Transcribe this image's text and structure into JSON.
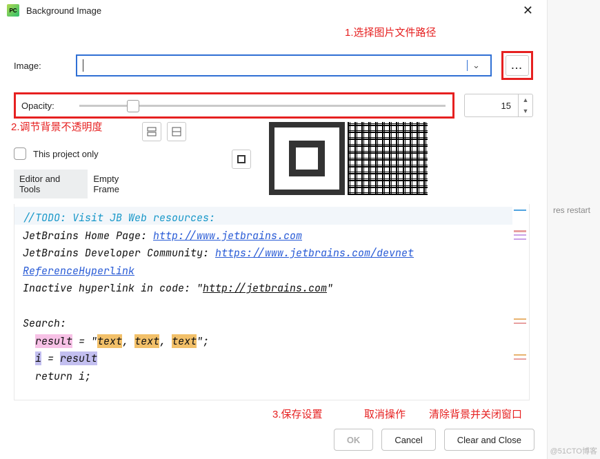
{
  "window": {
    "title": "Background Image",
    "close_glyph": "✕"
  },
  "annotations": {
    "a1": "1.选择图片文件路径",
    "a2": "2.调节背景不透明度",
    "a3": "3.保存设置",
    "a4": "取消操作",
    "a5": "清除背景并关闭窗口"
  },
  "image_row": {
    "label": "Image:",
    "value": "",
    "browse": "..."
  },
  "opacity_row": {
    "label": "Opacity:",
    "value": "15"
  },
  "project_only": {
    "label": "This project only",
    "checked": false
  },
  "tabs": {
    "editorTools": "Editor and Tools",
    "emptyFrame": "Empty Frame"
  },
  "code": {
    "l1": "//TODO: Visit JB Web resources:",
    "l2a": "JetBrains Home Page: ",
    "l2b": "http://www.jetbrains.com",
    "l3a": "JetBrains Developer Community: ",
    "l3b": "https://www.jetbrains.com/devnet",
    "l4": "ReferenceHyperlink",
    "l5a": "Inactive hyperlink in code: \"",
    "l5b": "http://jetbrains.com",
    "l5c": "\"",
    "l7": "Search:",
    "l8_result": "result",
    "l8_eq": " = \"",
    "l8_t1": "text",
    "l8_comma": ", ",
    "l8_end": "\";",
    "l9_i": "i",
    "l9_eq": " = ",
    "l9_res": "result",
    "l10": "return i;"
  },
  "buttons": {
    "ok": "OK",
    "cancel": "Cancel",
    "clear": "Clear and Close"
  },
  "background_text": {
    "restart_hint": "res restart",
    "watermark": "@51CTO博客"
  },
  "colors": {
    "accent": "#2f6fd4",
    "annotation": "#e62020"
  }
}
